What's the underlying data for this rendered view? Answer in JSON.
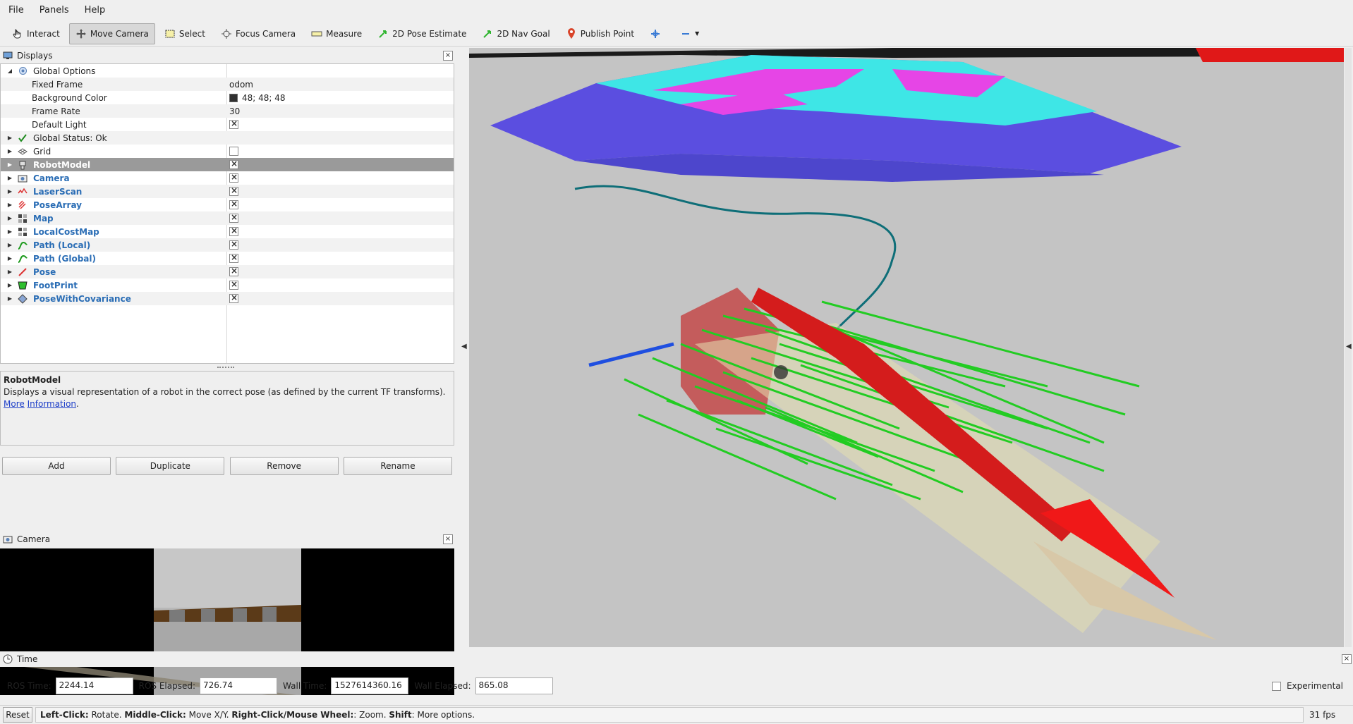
{
  "menu": [
    "File",
    "Panels",
    "Help"
  ],
  "toolbar": {
    "interact": "Interact",
    "move_camera": "Move Camera",
    "select": "Select",
    "focus_camera": "Focus Camera",
    "measure": "Measure",
    "pose_estimate": "2D Pose Estimate",
    "nav_goal": "2D Nav Goal",
    "publish_point": "Publish Point"
  },
  "displays": {
    "title": "Displays",
    "global_options": "Global Options",
    "fixed_frame_label": "Fixed Frame",
    "fixed_frame_value": "odom",
    "bg_color_label": "Background Color",
    "bg_color_value": "48; 48; 48",
    "frame_rate_label": "Frame Rate",
    "frame_rate_value": "30",
    "default_light_label": "Default Light",
    "global_status": "Global Status: Ok",
    "items": [
      "Grid",
      "RobotModel",
      "Camera",
      "LaserScan",
      "PoseArray",
      "Map",
      "LocalCostMap",
      "Path (Local)",
      "Path (Global)",
      "Pose",
      "FootPrint",
      "PoseWithCovariance"
    ]
  },
  "description": {
    "title": "RobotModel",
    "text": "Displays a visual representation of a robot in the correct pose (as defined by the current TF transforms).",
    "link1": "More",
    "link2": "Information"
  },
  "buttons": {
    "add": "Add",
    "duplicate": "Duplicate",
    "remove": "Remove",
    "rename": "Rename"
  },
  "camera_panel": {
    "title": "Camera"
  },
  "time": {
    "title": "Time",
    "ros_time_label": "ROS Time:",
    "ros_time": "2244.14",
    "ros_elapsed_label": "ROS Elapsed:",
    "ros_elapsed": "726.74",
    "wall_time_label": "Wall Time:",
    "wall_time": "1527614360.16",
    "wall_elapsed_label": "Wall Elapsed:",
    "wall_elapsed": "865.08",
    "experimental": "Experimental"
  },
  "status": {
    "reset": "Reset",
    "h1b": "Left-Click:",
    "h1": " Rotate. ",
    "h2b": "Middle-Click:",
    "h2": " Move X/Y. ",
    "h3b": "Right-Click/Mouse Wheel:",
    "h3": ": Zoom. ",
    "h4b": "Shift",
    "h4": ": More options.",
    "fps": "31 fps"
  }
}
